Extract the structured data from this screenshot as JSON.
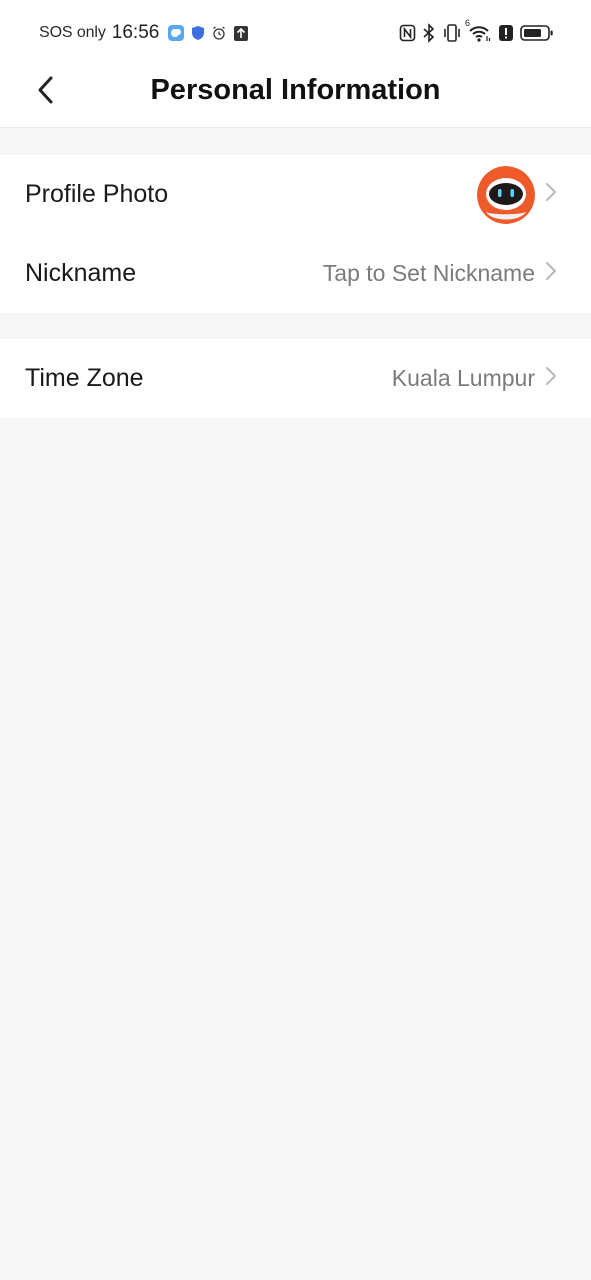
{
  "status_bar": {
    "carrier": "SOS only",
    "time": "16:56",
    "signal_superscript": "6",
    "icons_left": [
      "weather-app-icon",
      "shield-icon",
      "alarm-icon",
      "upload-icon"
    ],
    "icons_right": [
      "nfc-icon",
      "bluetooth-icon",
      "vibrate-icon",
      "wifi-icon",
      "alert-icon",
      "battery-icon"
    ]
  },
  "header": {
    "title": "Personal Information",
    "back_icon": "chevron-left-icon"
  },
  "sections": {
    "profile": {
      "photo_label": "Profile Photo",
      "nickname_label": "Nickname",
      "nickname_value": "Tap to Set Nickname"
    },
    "settings": {
      "timezone_label": "Time Zone",
      "timezone_value": "Kuala Lumpur"
    }
  },
  "colors": {
    "background": "#f6f6f6",
    "card": "#ffffff",
    "value_text": "#7b7b7b",
    "chevron": "#b8b8b8",
    "avatar_accent": "#ef5a2a"
  }
}
